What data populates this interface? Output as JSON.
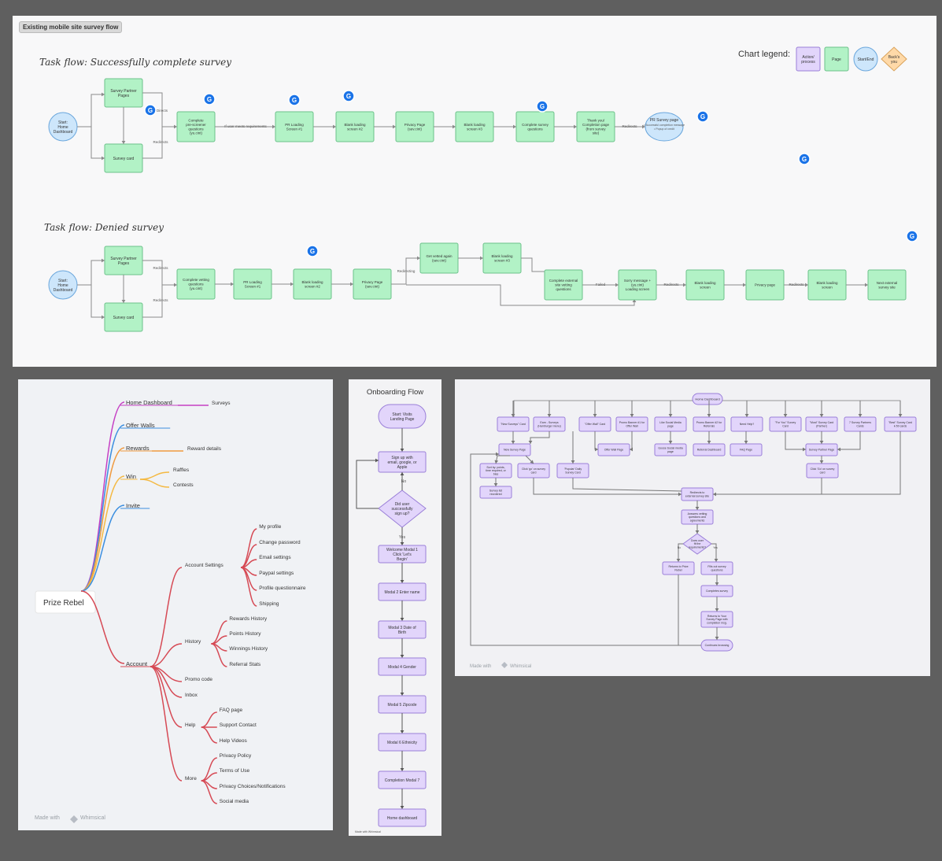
{
  "board": {
    "tag": "Existing mobile site survey flow"
  },
  "top": {
    "flow1_title": "Task flow: Successfully complete survey",
    "flow2_title": "Task flow: Denied survey",
    "legend": {
      "title": "Chart legend:",
      "items": [
        "Action/ process",
        "Page",
        "Start/End",
        "Back's you"
      ]
    },
    "avatar": "G",
    "flow1": {
      "start": "Start: Home Dashboard",
      "partner": "Survey Partner Pages",
      "card": "Survey card",
      "directs": "Directs",
      "redirects": "Redirects",
      "prescreen": "Complete pre-screener questions (yu.cint)",
      "meets": "If user meets requirements",
      "n1": "PR Loading Screen #1",
      "n2": "Blank loading screen #2",
      "n3": "Privacy Page (sev.cint)",
      "n4": "Blank loading screen #3",
      "n5": "Complete survey questions",
      "n6": "Thank you/ Completion page (from survey site)",
      "redirects2": "Redirects",
      "end": "PR Survey page",
      "end_lines": [
        "• Successful completion message",
        "• Popup of credit"
      ]
    },
    "flow2": {
      "start": "Start: Home Dashboard",
      "partner": "Survey Partner Pages",
      "card": "Survey card",
      "redirects": "Redirects",
      "vetting": "Complete vetting questions (yu.cint)",
      "n1": "PR Loading Screen #1",
      "n2": "Blank loading screen #2",
      "n3": "Privacy Page (sev.cint)",
      "redirecting": "Redirecting",
      "vetted": "Get vetted again (sev.cint)",
      "blank3": "Blank loading screen #3",
      "external": "Complete external site vetting questions",
      "failed": "Failed",
      "sorry": "Sorry message + (yu.cint) Loading screen",
      "redirects2": "Redirects",
      "blank": "Blank loading screen",
      "privacy": "Privacy page",
      "redirects3": "Redirects",
      "blank2": "Blank loading screen",
      "next": "Next external survey site"
    }
  },
  "mind": {
    "root": "Prize Rebel",
    "branches": [
      {
        "label": "Home Dashboard",
        "children": [
          "Surveys"
        ]
      },
      {
        "label": "Offer Walls",
        "children": []
      },
      {
        "label": "Rewards",
        "children": [
          "Reward details"
        ]
      },
      {
        "label": "Win",
        "children": [
          "Raffles",
          "Contests"
        ]
      },
      {
        "label": "Invite",
        "children": []
      },
      {
        "label": "Account",
        "children": [
          {
            "label": "Account Settings",
            "children": [
              "My profile",
              "Change password",
              "Email settings",
              "Paypal settings",
              "Profile questionnaire",
              "Shipping"
            ]
          },
          {
            "label": "History",
            "children": [
              "Rewards History",
              "Points History",
              "Winnings History",
              "Referral Stats"
            ]
          },
          {
            "label": "Promo code",
            "children": []
          },
          {
            "label": "Inbox",
            "children": []
          },
          {
            "label": "Help",
            "children": [
              "FAQ page",
              "Support Contact",
              "Help Videos"
            ]
          },
          {
            "label": "More",
            "children": [
              "Privacy Policy",
              "Terms of Use",
              "Privacy Choices/Notifications",
              "Social media"
            ]
          }
        ]
      }
    ],
    "footer": "Made with",
    "brand": "Whimsical"
  },
  "onboarding": {
    "title": "Onboarding Flow",
    "start": "Start: Visits Landing Page",
    "signup": "Sign up with email, google, or Apple",
    "decision": "Did user successfully sign up?",
    "no": "No",
    "yes": "Yes",
    "steps": [
      "Welcome Modal 1 Click 'Let's Begin'",
      "Modal 2 Enter name",
      "Modal 3 Date of Birth",
      "Modal 4 Gender",
      "Modal 5 Zipcode",
      "Modal 6 Ethnicity",
      "Completion Modal 7",
      "Home dashboard"
    ],
    "footer": "Made with Whimsical"
  },
  "flowchart": {
    "home": "Home Dashboard",
    "row1": [
      "\"New Surveys\" Card",
      "Earn - Surveys (Hamburger menu)",
      "\"Offer Wall\" Card",
      "Promo Banner #1 for Offer Wall",
      "Like Social Media page",
      "Promo Banner #2 for Referrals",
      "Need Help?",
      "\"For You\" Survey Card",
      "\"Most\" Survey Card (Partner)",
      "7 Survey Partners Cards",
      "\"Best\" Survey Card k-50 cards"
    ],
    "row2": [
      "New Survey Page",
      "Offer Wall Page",
      "Goose Social media page",
      "Referral Dashboard",
      "FAQ Page",
      "Survey Partner Page"
    ],
    "row3": [
      "Sort by: points, time required, or bias",
      "Click 'go' on survey card",
      "'Popular' Daily Survey Card",
      "Click 'Go' on survey card"
    ],
    "row4": [
      "Survey list reordered"
    ],
    "redirect": "Redirects to external survey site",
    "answers": "Answers vetting questions and agreements",
    "decision": "Does user fit the requirements?",
    "no": "No",
    "yes": "Yes",
    "return": "Returns to Prize Rebel",
    "fills": "Fills out survey questions",
    "complete": "Completes survey",
    "returns": "Returns to Your Survey Page with completion msg.",
    "continue": "Continues browsing",
    "footer": "Made with",
    "brand": "Whimsical"
  },
  "colors": {
    "page": "#b2f2c6",
    "page_border": "#6cc28a",
    "action": "#e2d5fb",
    "action_border": "#9a7fd8",
    "start": "#cde6fb",
    "start_border": "#6aa6dc",
    "decision": "#ffd9a8",
    "mind_pink": "#c540c4",
    "mind_blue": "#3b8ee0",
    "mind_orange": "#f09a3e",
    "mind_yellow": "#f4b942",
    "mind_red": "#d64a55"
  }
}
